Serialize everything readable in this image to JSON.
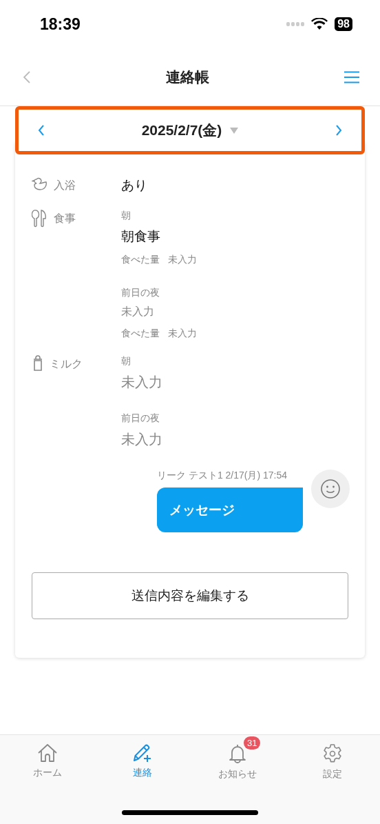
{
  "status_bar": {
    "time": "18:39",
    "battery": "98"
  },
  "nav": {
    "title": "連絡帳"
  },
  "date_bar": {
    "date": "2025/2/7(金)",
    "highlighted": true
  },
  "records": [
    {
      "kind": "bath",
      "label": "入浴",
      "value": "あり"
    },
    {
      "kind": "meal",
      "label": "食事",
      "entries": [
        {
          "time": "朝",
          "value": "朝食事",
          "entered": true,
          "amount_label": "食べた量",
          "amount": "未入力"
        },
        {
          "time": "前日の夜",
          "value": "未入力",
          "entered": false,
          "amount_label": "食べた量",
          "amount": "未入力"
        }
      ]
    },
    {
      "kind": "milk",
      "label": "ミルク",
      "entries": [
        {
          "time": "朝",
          "value": "未入力",
          "entered": false
        },
        {
          "time": "前日の夜",
          "value": "未入力",
          "entered": false
        }
      ]
    }
  ],
  "message": {
    "meta": "リーク テスト1 2/17(月) 17:54",
    "text": "メッセージ"
  },
  "edit_button": "送信内容を編集する",
  "tabs": [
    {
      "kind": "home",
      "label": "ホーム",
      "selected": false
    },
    {
      "kind": "contact",
      "label": "連絡",
      "selected": true
    },
    {
      "kind": "notice",
      "label": "お知らせ",
      "selected": false,
      "badge": "31"
    },
    {
      "kind": "settings",
      "label": "設定",
      "selected": false
    }
  ]
}
